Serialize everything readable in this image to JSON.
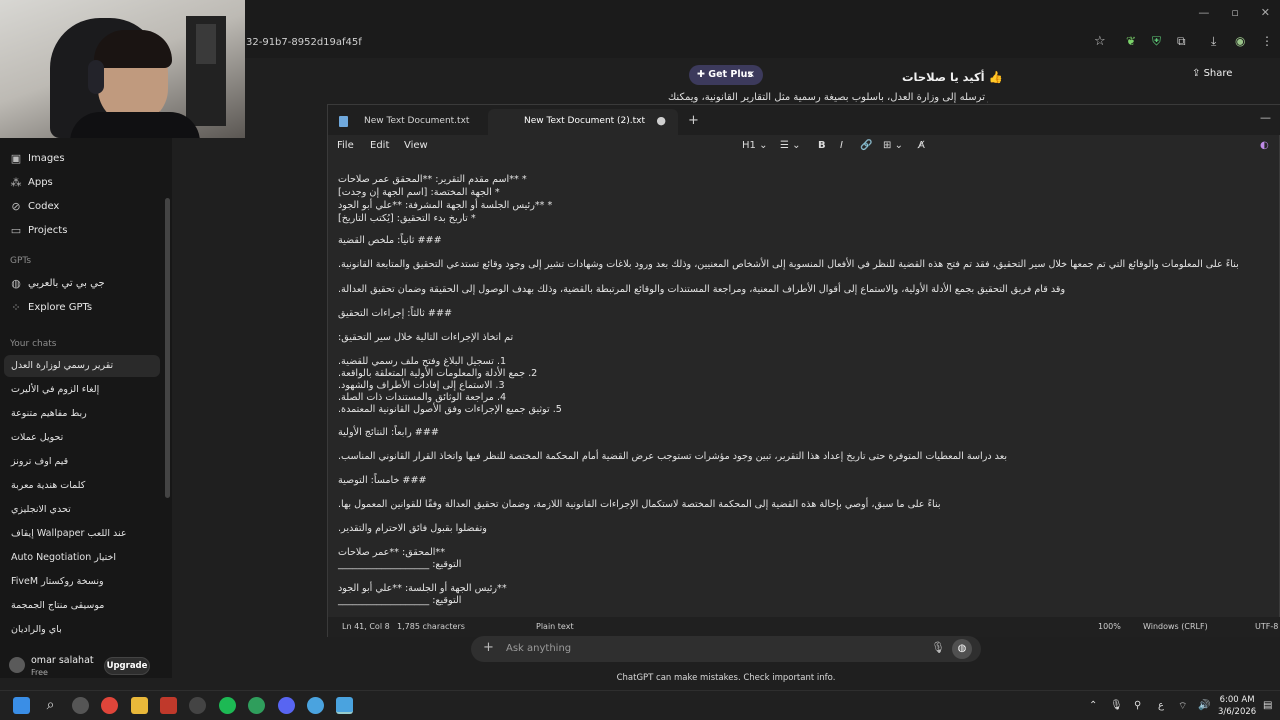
{
  "browser": {
    "url_fragment": "32-91b7-8952d19af45f"
  },
  "sidebar": {
    "top_items": [
      {
        "icon": "images-icon",
        "label": "Images"
      },
      {
        "icon": "apps-icon",
        "label": "Apps"
      },
      {
        "icon": "codex-icon",
        "label": "Codex"
      },
      {
        "icon": "projects-icon",
        "label": "Projects"
      }
    ],
    "gpts_heading": "GPTs",
    "gpts": [
      {
        "label": "جي بي تي بالعربي"
      },
      {
        "label": "Explore GPTs"
      }
    ],
    "chats_heading": "Your chats",
    "chats": [
      "تقرير رسمي لوزارة العدل",
      "إلغاء الزوم في الأليرت",
      "ربط مفاهيم متنوعة",
      "تحويل عملات",
      "قيم اوف ترونز",
      "كلمات هندية معربة",
      "تحدي الانجليزي",
      "إيقاف Wallpaper عند اللعب",
      "Auto Negotiation اختيار",
      "FiveM ونسخة روكستار",
      "موسيقى منتاج الجمجمة",
      "باي والراديان"
    ],
    "user": {
      "name": "omar salahat",
      "plan": "Free",
      "upgrade": "Upgrade"
    }
  },
  "chatgpt": {
    "get_plus": "Get Plus",
    "get_plus_close": "×",
    "title": "أكيد يا صلاحات 👍",
    "share": "Share",
    "behind_text": "يكتب لك نموذج تقرير رسمي منسق، تقدر ترسله إلى وزارة العدل، بأسلوب بصيغة رسمية مثل التقارير القانونية، ويمكنك",
    "composer_placeholder": "Ask anything",
    "disclaimer": "ChatGPT can make mistakes. Check important info."
  },
  "notepad": {
    "tabs": [
      "New Text Document.txt",
      "New Text Document (2).txt"
    ],
    "unsaved_dot": "●",
    "new_tab": "+",
    "menu": [
      "File",
      "Edit",
      "View"
    ],
    "toolbar": {
      "heading": "H1",
      "list": "☰",
      "bold": "B",
      "italic": "I",
      "link": "🔗",
      "table": "⊞",
      "clear": "A̸"
    },
    "lines": [
      "* **اسم مقدم التقرير: **المحقق عمر صلاحات",
      "* الجهة المختصة: [اسم الجهة إن وجدت]",
      "* **رئيس الجلسة أو الجهة المشرفة: **علي أبو الجود",
      "* تاريخ بدء التحقيق: [يُكتب التاريخ]",
      "### ثانياً: ملخص القضية",
      "بناءً على المعلومات والوقائع التي تم جمعها خلال سير التحقيق، فقد تم فتح هذه القضية للنظر في الأفعال المنسوبة إلى الأشخاص المعنيين، وذلك بعد ورود بلاغات وشهادات تشير إلى وجود وقائع تستدعي التحقيق والمتابعة القانونية.",
      "وقد قام فريق التحقيق بجمع الأدلة الأولية، والاستماع إلى أقوال الأطراف المعنية، ومراجعة المستندات والوقائع المرتبطة بالقضية، وذلك بهدف الوصول إلى الحقيقة وضمان تحقيق العدالة.",
      "### ثالثاً: إجراءات التحقيق",
      "تم اتخاذ الإجراءات التالية خلال سير التحقيق:",
      "1. تسجيل البلاغ وفتح ملف رسمي للقضية.",
      "2. جمع الأدلة والمعلومات الأولية المتعلقة بالواقعة.",
      "3. الاستماع إلى إفادات الأطراف والشهود.",
      "4. مراجعة الوثائق والمستندات ذات الصلة.",
      "5. توثيق جميع الإجراءات وفق الأصول القانونية المعتمدة.",
      "### رابعاً: النتائج الأولية",
      "بعد دراسة المعطيات المتوفرة حتى تاريخ إعداد هذا التقرير، تبين وجود مؤشرات تستوجب عرض القضية أمام المحكمة المختصة للنظر فيها واتخاذ القرار القانوني المناسب.",
      "### خامساً: التوصية",
      "بناءً على ما سبق، أوصي بإحالة هذه القضية إلى المحكمة المختصة لاستكمال الإجراءات القانونية اللازمة، وضمان تحقيق العدالة وفقًا للقوانين المعمول بها.",
      "وتفضلوا بقبول فائق الاحترام والتقدير.",
      "**المحقق: **عمر صلاحات",
      "التوقيع: ___________________",
      "**رئيس الجهة أو الجلسة: **علي أبو الجود",
      "التوقيع: ___________________"
    ],
    "status": {
      "position": "Ln 41, Col 8",
      "chars": "1,785 characters",
      "format": "Plain text",
      "zoom": "100%",
      "eol": "Windows (CRLF)",
      "encoding": "UTF-8"
    }
  },
  "taskbar": {
    "time": "6:00 AM",
    "date": "3/6/2026",
    "lang": "ع"
  }
}
